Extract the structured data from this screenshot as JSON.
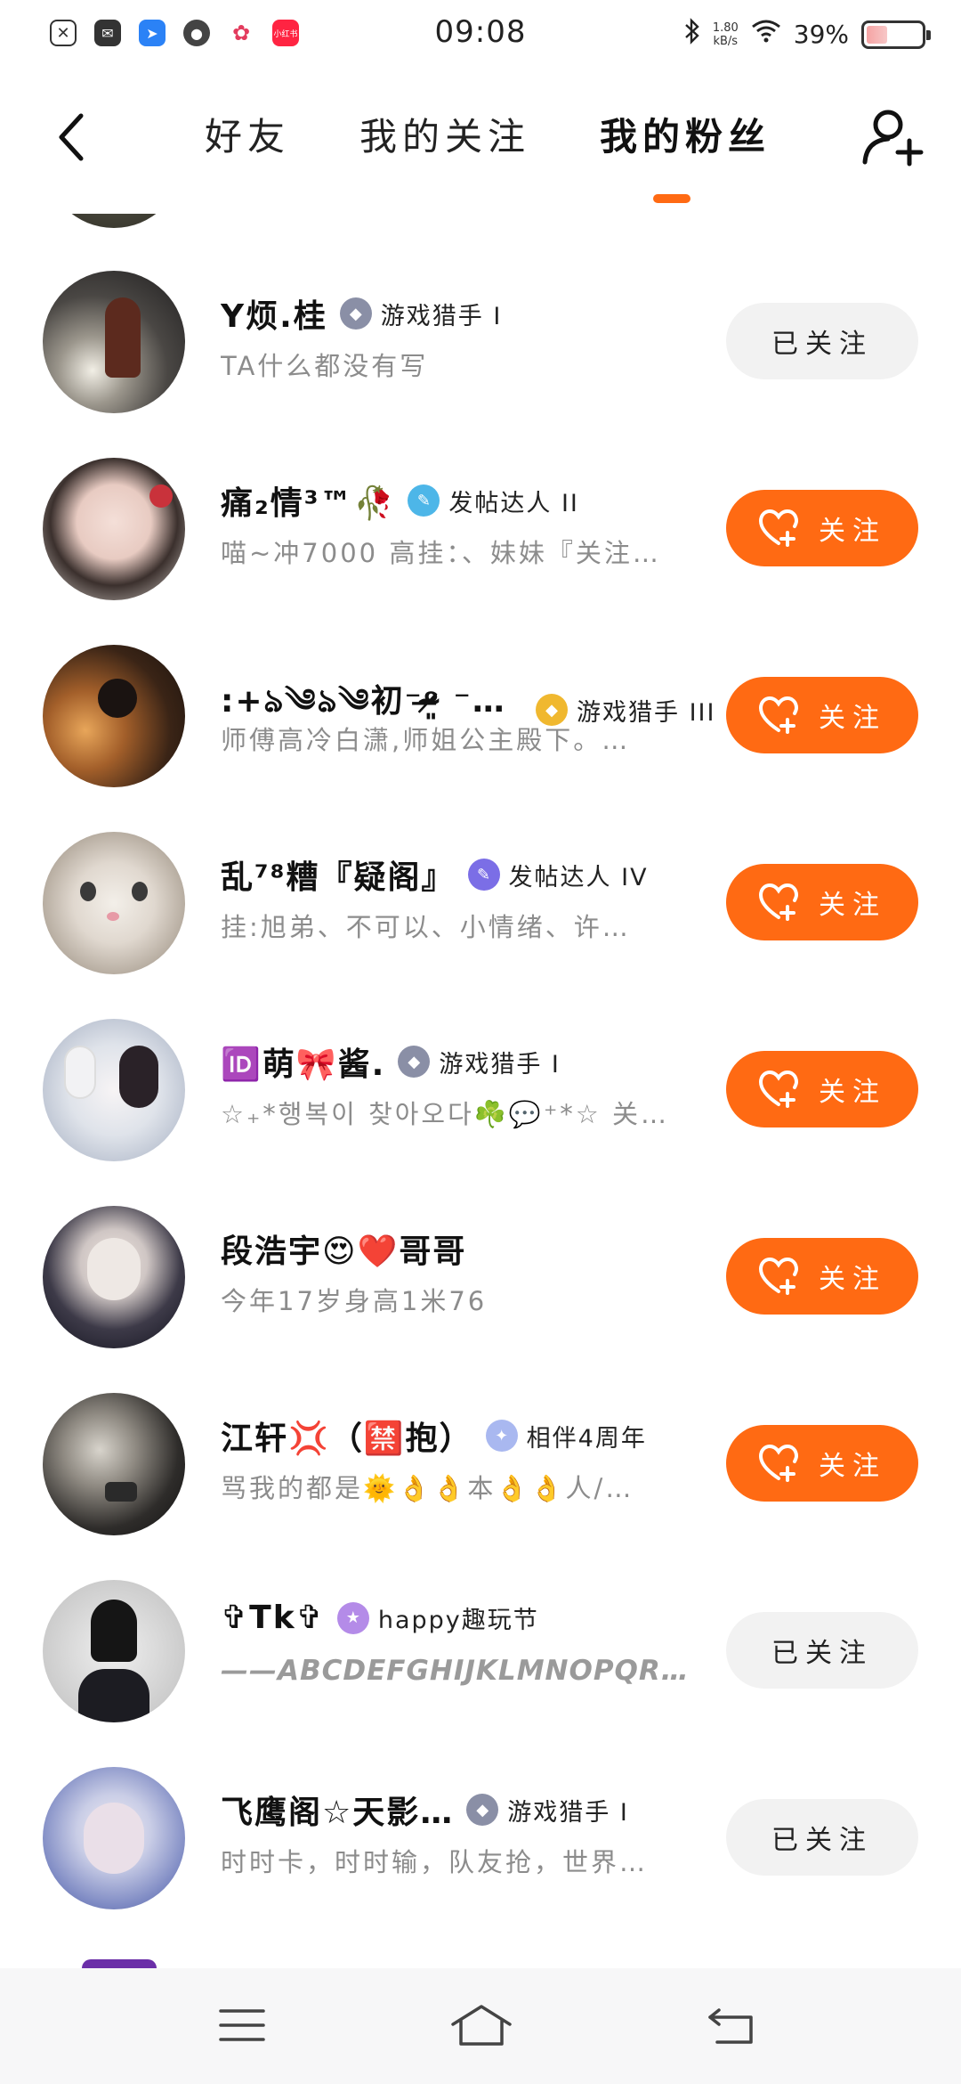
{
  "status_bar": {
    "time": "09:08",
    "net_speed_value": "1.80",
    "net_speed_unit": "kB/s",
    "battery": "39%",
    "battery_level": 0.39,
    "app_icons": [
      "notification-icon",
      "mail-icon",
      "app-icon-blue",
      "app-icon-dark",
      "app-icon-pink",
      "xiaohongshu-icon"
    ],
    "xhs_label": "小红书"
  },
  "header": {
    "tabs": [
      {
        "label": "好友",
        "active": false
      },
      {
        "label": "我的关注",
        "active": false
      },
      {
        "label": "我的粉丝",
        "active": true
      }
    ],
    "accent_color": "#ff6a13"
  },
  "followers": [
    {
      "name": "Y烦.桂",
      "badge": "游戏猎手 I",
      "badge_icon": "game-hunter-badge-icon",
      "bio": "TA什么都没有写",
      "button": "已关注",
      "following": true
    },
    {
      "name": "痛₂情³™🥀",
      "badge": "发帖达人 II",
      "badge_icon": "poster-badge-icon",
      "bio": "喵~冲7000 高挂：、妹妹『关注…",
      "button": "关注",
      "following": false
    },
    {
      "name": ":+ঌ༄ঌ༄初⁻ᵒ̴̶̷͈ ⁻梦…",
      "badge": "游戏猎手 III",
      "badge_icon": "game-hunter-badge-icon",
      "bio": "师傅高冷白潇,师姐公主殿下。…",
      "button": "关注",
      "following": false
    },
    {
      "name": "乱⁷⁸糟『疑阁』",
      "badge": "发帖达人 IV",
      "badge_icon": "poster-badge-icon",
      "bio": "挂:旭弟、不可以、小情绪、许…",
      "button": "关注",
      "following": false
    },
    {
      "name": "🆔萌🎀酱.",
      "badge": "游戏猎手 I",
      "badge_icon": "game-hunter-badge-icon",
      "bio": "☆₊*행복이 찾아오다☘️💬⁺*☆ 关…",
      "button": "关注",
      "following": false
    },
    {
      "name": "段浩宇😍❤️哥哥",
      "badge": "",
      "badge_icon": "",
      "bio": "今年17岁身高1米76",
      "button": "关注",
      "following": false
    },
    {
      "name": "江轩💢（🈲抱）",
      "badge": "相伴4周年",
      "badge_icon": "anniversary-badge-icon",
      "bio": "骂我的都是🌞👌👌本👌👌人￼/…",
      "button": "关注",
      "following": false
    },
    {
      "name": "✞Tk✞",
      "badge": "happy趣玩节",
      "badge_icon": "happy-fest-badge-icon",
      "bio": "——ABCDEFGHIJKLMNOPQR…",
      "button": "已关注",
      "following": true
    },
    {
      "name": "飞鹰阁☆天影…",
      "badge": "游戏猎手 I",
      "badge_icon": "game-hunter-badge-icon",
      "bio": "时时卡，时时输，队友抢，世界…",
      "button": "已关注",
      "following": true
    }
  ]
}
